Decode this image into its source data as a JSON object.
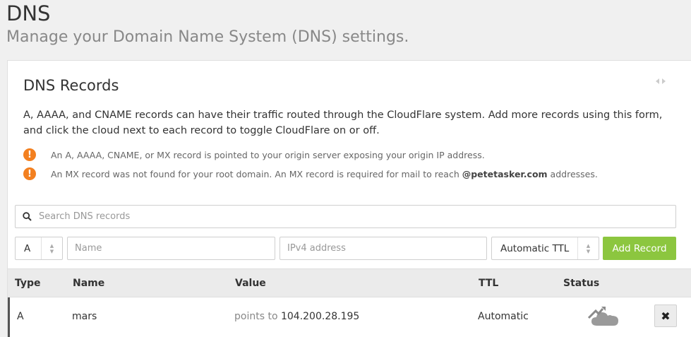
{
  "header": {
    "title": "DNS",
    "subtitle": "Manage your Domain Name System (DNS) settings."
  },
  "card": {
    "title": "DNS Records",
    "intro": "A, AAAA, and CNAME records can have their traffic routed through the CloudFlare system. Add more records using this form, and click the cloud next to each record to toggle CloudFlare on or off.",
    "warnings": [
      {
        "icon": "warning-icon",
        "text": "An A, AAAA, CNAME, or MX record is pointed to your origin server exposing your origin IP address."
      },
      {
        "icon": "warning-icon",
        "text_before": "An MX record was not found for your root domain. An MX record is required for mail to reach ",
        "domain": "@petetasker.com",
        "text_after": " addresses."
      }
    ],
    "warning_color": "#f38020"
  },
  "search": {
    "icon": "search-icon",
    "placeholder": "Search DNS records"
  },
  "form": {
    "type_value": "A",
    "name_placeholder": "Name",
    "value_placeholder": "IPv4 address",
    "ttl_value": "Automatic TTL",
    "add_label": "Add Record",
    "add_color": "#8cc63f"
  },
  "table": {
    "columns": [
      "Type",
      "Name",
      "Value",
      "TTL",
      "Status"
    ],
    "rows": [
      {
        "type": "A",
        "name": "mars",
        "value_prefix": "points to",
        "value": "104.200.28.195",
        "ttl": "Automatic",
        "status_icon": "cloud-icon",
        "delete_icon": "close-icon"
      }
    ]
  }
}
